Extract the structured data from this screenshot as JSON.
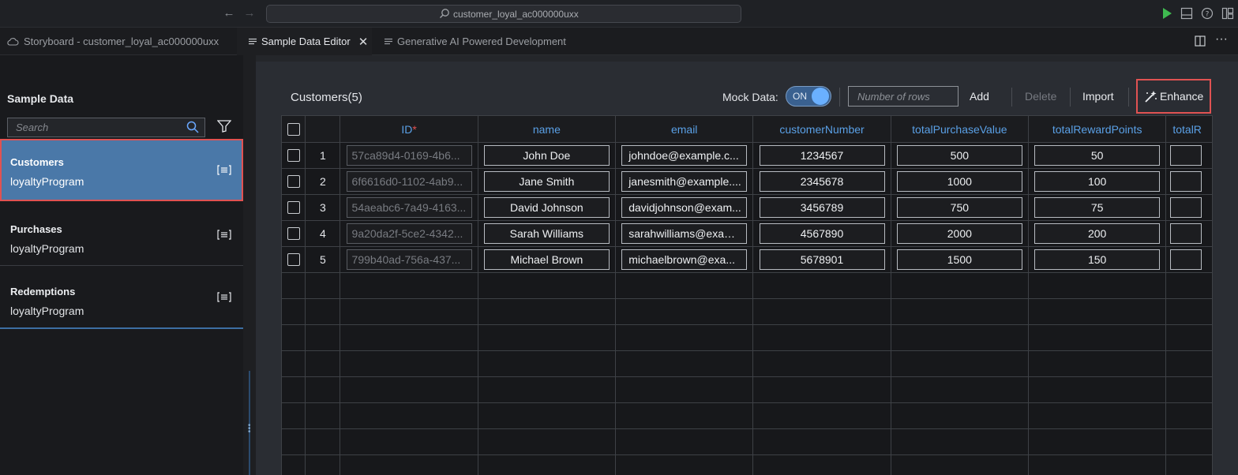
{
  "titlebar": {
    "search_text": "customer_loyal_ac000000uxx",
    "icons": [
      "back-arrow-icon",
      "forward-arrow-icon",
      "search-icon",
      "run-icon",
      "layout-icon",
      "help-icon",
      "panels-icon"
    ]
  },
  "tabs": [
    {
      "label": "Storyboard - customer_loyal_ac000000uxx",
      "icon": "cloud-icon"
    },
    {
      "label": "Sample Data Editor",
      "icon": "editor-icon",
      "active": true
    },
    {
      "label": "Generative AI Powered Development",
      "icon": "document-icon"
    }
  ],
  "sidebar": {
    "title": "Sample Data",
    "search_placeholder": "Search",
    "entities": [
      {
        "name": "Customers",
        "service": "loyaltyProgram",
        "selected": true
      },
      {
        "name": "Purchases",
        "service": "loyaltyProgram"
      },
      {
        "name": "Redemptions",
        "service": "loyaltyProgram"
      }
    ]
  },
  "toolbar": {
    "entity_title": "Customers(5)",
    "mock_label": "Mock Data:",
    "toggle_label": "ON",
    "rows_placeholder": "Number of rows",
    "add": "Add",
    "delete": "Delete",
    "import": "Import",
    "enhance": "Enhance"
  },
  "table": {
    "columns": [
      "ID",
      "name",
      "email",
      "customerNumber",
      "totalPurchaseValue",
      "totalRewardPoints",
      "totalR"
    ],
    "rows": [
      {
        "n": "1",
        "id": "57ca89d4-0169-4b6...",
        "name": "John Doe",
        "email": "johndoe@example.c...",
        "customerNumber": "1234567",
        "totalPurchaseValue": "500",
        "totalRewardPoints": "50"
      },
      {
        "n": "2",
        "id": "6f6616d0-1102-4ab9...",
        "name": "Jane Smith",
        "email": "janesmith@example....",
        "customerNumber": "2345678",
        "totalPurchaseValue": "1000",
        "totalRewardPoints": "100"
      },
      {
        "n": "3",
        "id": "54aeabc6-7a49-4163...",
        "name": "David Johnson",
        "email": "davidjohnson@exam...",
        "customerNumber": "3456789",
        "totalPurchaseValue": "750",
        "totalRewardPoints": "75"
      },
      {
        "n": "4",
        "id": "9a20da2f-5ce2-4342...",
        "name": "Sarah Williams",
        "email": "sarahwilliams@exam...",
        "customerNumber": "4567890",
        "totalPurchaseValue": "2000",
        "totalRewardPoints": "200"
      },
      {
        "n": "5",
        "id": "799b40ad-756a-437...",
        "name": "Michael Brown",
        "email": "michaelbrown@exa...",
        "customerNumber": "5678901",
        "totalPurchaseValue": "1500",
        "totalRewardPoints": "150"
      }
    ]
  },
  "colors": {
    "accent": "#4a78a8",
    "highlight": "#e05252",
    "header_text": "#5aa0e6",
    "run": "#3fb950"
  }
}
